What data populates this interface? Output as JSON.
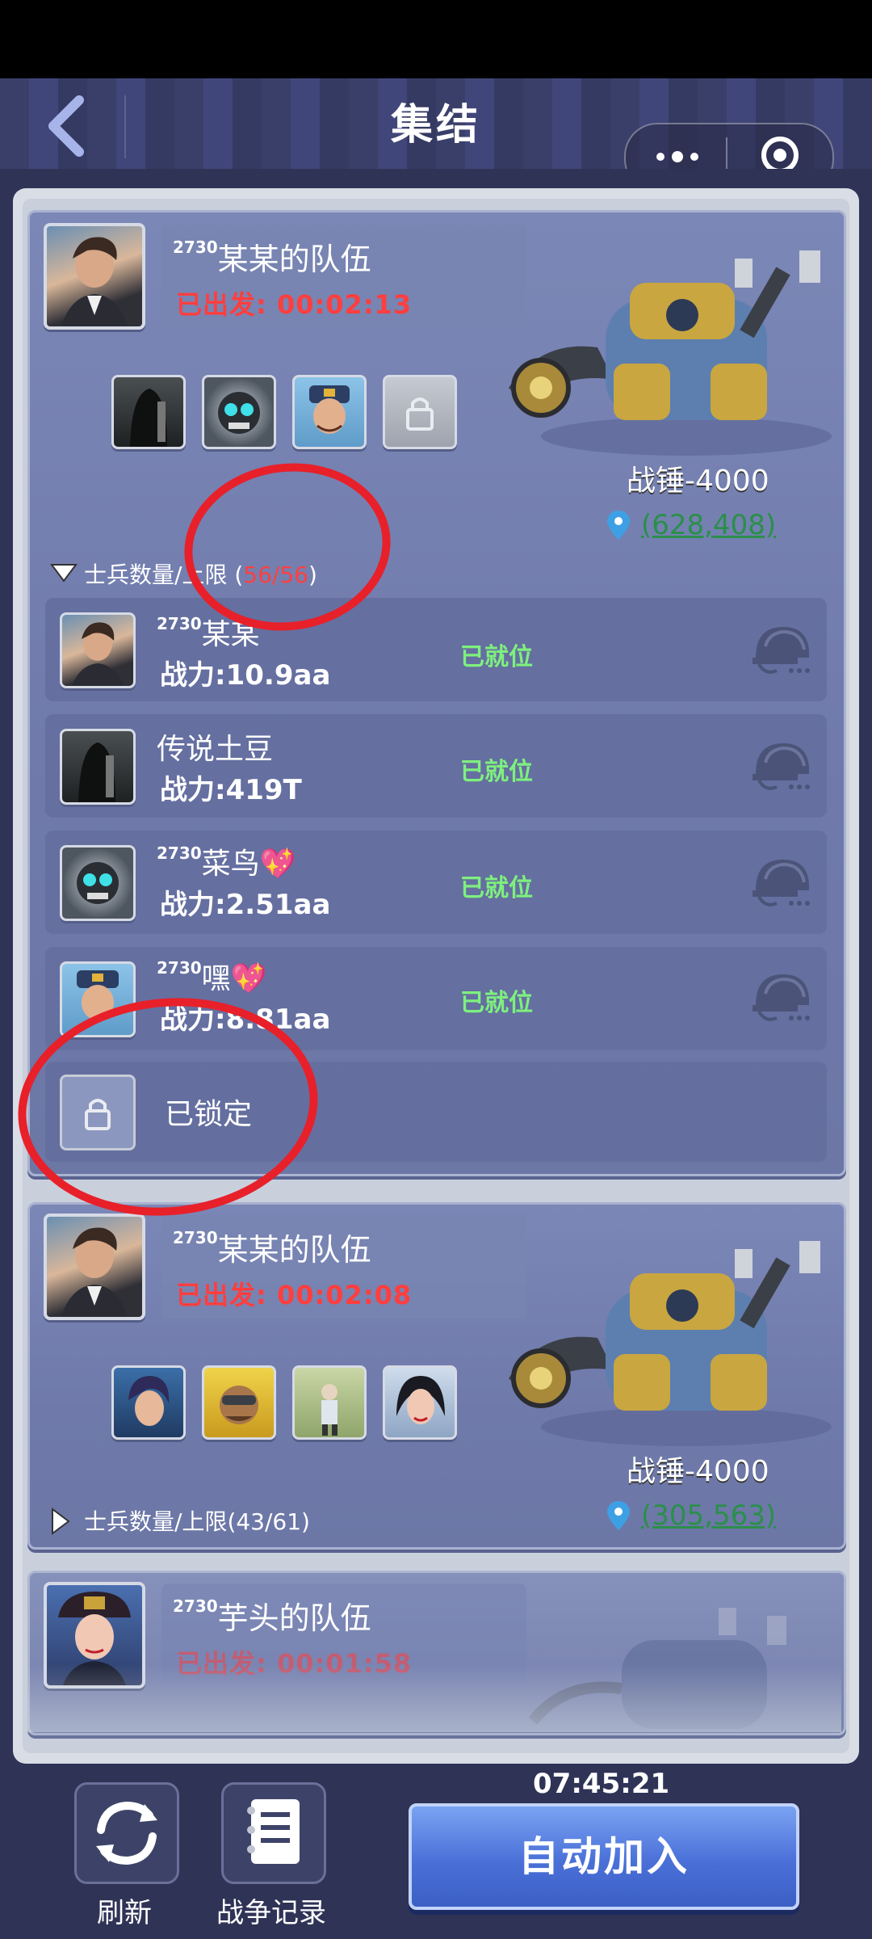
{
  "header": {
    "title": "集结"
  },
  "teams": [
    {
      "server": "2730",
      "team_name": "某某的队伍",
      "depart_label": "已出发:",
      "depart_time": "00:02:13",
      "mech_name": "战锤-4000",
      "coord": "(628,408)",
      "soldiers_label": "士兵数量/上限",
      "soldiers_open": "(",
      "soldiers_count": "56/56",
      "soldiers_close": ")",
      "members": [
        {
          "server": "2730",
          "name": "某某",
          "power_label": "战力:",
          "power": "10.9aa",
          "status": "已就位",
          "badge": ""
        },
        {
          "server": "",
          "name": "传说土豆",
          "power_label": "战力:",
          "power": "419T",
          "status": "已就位",
          "badge": ""
        },
        {
          "server": "2730",
          "name": "菜鸟",
          "power_label": "战力:",
          "power": "2.51aa",
          "status": "已就位",
          "badge": "💖"
        },
        {
          "server": "2730",
          "name": "嘿",
          "power_label": "战力:",
          "power": "8.81aa",
          "status": "已就位",
          "badge": "💖"
        }
      ],
      "locked_label": "已锁定"
    },
    {
      "server": "2730",
      "team_name": "某某的队伍",
      "depart_label": "已出发:",
      "depart_time": "00:02:08",
      "mech_name": "战锤-4000",
      "coord": "(305,563)",
      "soldiers_label": "士兵数量/上限",
      "soldiers_value": "(43/61)"
    },
    {
      "server": "2730",
      "team_name": "芋头的队伍",
      "depart_label": "已出发:",
      "depart_time": "00:01:58"
    }
  ],
  "bottom": {
    "refresh_label": "刷新",
    "war_log_label": "战争记录",
    "countdown": "07:45:21",
    "auto_join_label": "自动加入"
  },
  "colors": {
    "accent": "#4a70d8",
    "depart": "#ff3e3e",
    "ready": "#7ef07e",
    "annotation": "#e8202a",
    "coord": "#2a8f4a"
  },
  "icons": [
    "back-arrow-icon",
    "more-dots-icon",
    "target-icon",
    "pin-icon",
    "helmet-icon",
    "lock-icon",
    "refresh-icon",
    "notebook-icon",
    "triangle-down-icon",
    "triangle-right-icon"
  ]
}
